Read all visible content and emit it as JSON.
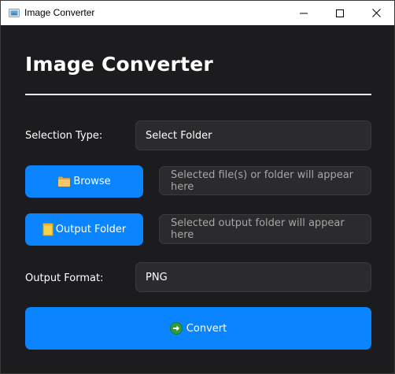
{
  "window": {
    "title": "Image Converter",
    "controls": [
      "minimize-icon",
      "maximize-icon",
      "close-icon"
    ]
  },
  "main": {
    "heading": "Image Converter",
    "selection_type": {
      "label": "Selection Type:",
      "value": "Select Folder"
    },
    "browse": {
      "button_label": "Browse",
      "icon": "folder-icon",
      "field_placeholder": "Selected file(s) or folder will appear here"
    },
    "output": {
      "button_label": "Output Folder",
      "icon": "notepad-icon",
      "field_placeholder": "Selected output folder will appear here"
    },
    "output_format": {
      "label": "Output Format:",
      "value": "PNG"
    },
    "convert": {
      "button_label": "Convert",
      "icon": "arrow-right-circle-icon"
    }
  },
  "colors": {
    "background": "#1c1c1e",
    "accent": "#0a84ff",
    "field_bg": "#2b2b2d",
    "placeholder_text": "#a7a7a7"
  }
}
